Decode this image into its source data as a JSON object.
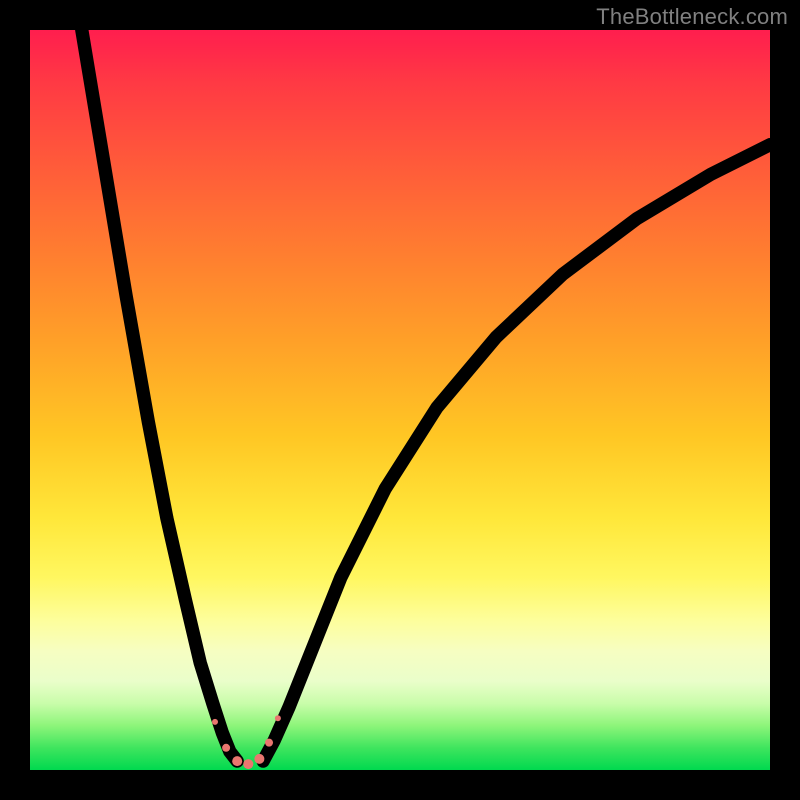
{
  "watermark": "TheBottleneck.com",
  "chart_data": {
    "type": "line",
    "title": "",
    "xlabel": "",
    "ylabel": "",
    "xlim": [
      0,
      100
    ],
    "ylim": [
      0,
      100
    ],
    "grid": false,
    "legend": false,
    "note": "V-shaped bottleneck curve over a vertical red→green gradient. Values are approximate, read from pixel positions within the 740×740 plot area. y is inverted (0 = top, 100 = bottom).",
    "series": [
      {
        "name": "left-branch",
        "x": [
          7.0,
          10.0,
          13.0,
          16.0,
          18.5,
          21.0,
          23.0,
          24.7,
          26.0,
          27.0,
          28.0
        ],
        "y": [
          0.0,
          18.0,
          36.0,
          53.0,
          66.0,
          77.0,
          85.5,
          91.0,
          95.0,
          97.5,
          98.8
        ]
      },
      {
        "name": "right-branch",
        "x": [
          31.5,
          33.0,
          35.0,
          38.0,
          42.0,
          48.0,
          55.0,
          63.0,
          72.0,
          82.0,
          92.0,
          100.0
        ],
        "y": [
          98.8,
          96.0,
          91.5,
          84.0,
          74.0,
          62.0,
          51.0,
          41.5,
          33.0,
          25.5,
          19.5,
          15.5
        ]
      }
    ],
    "markers": {
      "name": "bottom-cluster",
      "color": "#e9766f",
      "points": [
        {
          "x": 25.0,
          "y": 93.5,
          "r": 3
        },
        {
          "x": 26.5,
          "y": 97.0,
          "r": 4
        },
        {
          "x": 28.0,
          "y": 98.8,
          "r": 5
        },
        {
          "x": 29.5,
          "y": 99.2,
          "r": 5
        },
        {
          "x": 31.0,
          "y": 98.5,
          "r": 5
        },
        {
          "x": 32.3,
          "y": 96.3,
          "r": 4
        },
        {
          "x": 33.5,
          "y": 93.0,
          "r": 3
        }
      ]
    },
    "gradient_stops": [
      {
        "pos": 0,
        "color": "#ff1e4e"
      },
      {
        "pos": 30,
        "color": "#ff7d30"
      },
      {
        "pos": 66,
        "color": "#ffe73a"
      },
      {
        "pos": 84,
        "color": "#f6fec2"
      },
      {
        "pos": 100,
        "color": "#00d94f"
      }
    ]
  }
}
